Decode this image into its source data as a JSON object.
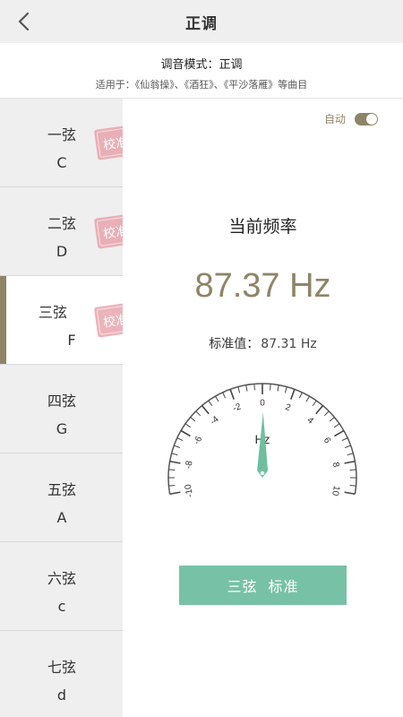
{
  "header": {
    "title": "正调"
  },
  "mode": {
    "label": "调音模式：正调",
    "songs": "适用于：《仙翁操》、《酒狂》、《平沙落雁》等曲目"
  },
  "strings": [
    {
      "name": "一弦",
      "note": "C",
      "stamp": "校准",
      "active": false
    },
    {
      "name": "二弦",
      "note": "D",
      "stamp": "校准",
      "active": false
    },
    {
      "name": "三弦",
      "note": "F",
      "stamp": "校准",
      "active": true
    },
    {
      "name": "四弦",
      "note": "G",
      "stamp": "",
      "active": false
    },
    {
      "name": "五弦",
      "note": "A",
      "stamp": "",
      "active": false
    },
    {
      "name": "六弦",
      "note": "c",
      "stamp": "",
      "active": false
    },
    {
      "name": "七弦",
      "note": "d",
      "stamp": "",
      "active": false
    }
  ],
  "panel": {
    "auto_label": "自动",
    "auto_on": true,
    "freq_title": "当前频率",
    "freq_value": "87.37 Hz",
    "std_label": "标准值：",
    "std_value": "87.31 Hz",
    "button_string": "三弦",
    "button_action": "标准"
  },
  "gauge": {
    "unit": "Hz",
    "min": -10,
    "max": 10,
    "labels": [
      "-10",
      "-8",
      "-6",
      "-4",
      "-2",
      "0",
      "2",
      "4",
      "6",
      "8",
      "10"
    ],
    "reading": 0.06
  },
  "colors": {
    "accent": "#8e8466",
    "green": "#77c2a6",
    "stamp": "#d9707a"
  }
}
